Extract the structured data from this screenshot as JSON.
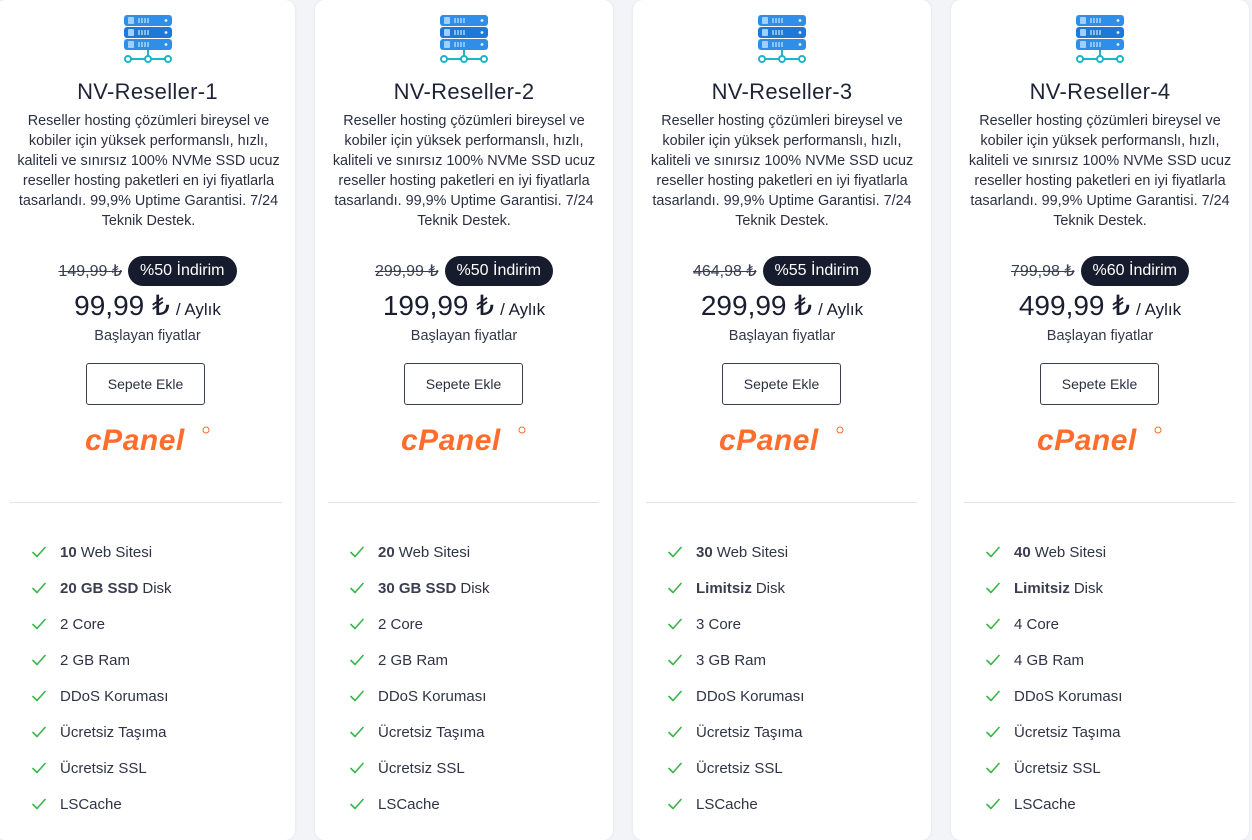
{
  "colors": {
    "page_bg": "#f3f4f8",
    "badge_bg": "#161b2d",
    "check_green": "#39b54a",
    "cpanel_orange": "#ff6c2c",
    "icon_blue": "#2a8de6"
  },
  "icons": {
    "plan": "server-icon",
    "feature": "check-icon",
    "logo": "cpanel-logo"
  },
  "common": {
    "description": "Reseller hosting çözümleri bireysel ve kobiler için yüksek performanslı, hızlı, kaliteli ve sınırsız 100% NVMe SSD ucuz reseller hosting paketleri en iyi fiyatlarla tasarlandı. 99,9% Uptime Garantisi. 7/24 Teknik Destek.",
    "period": "/ Aylık",
    "starting_label": "Başlayan fiyatlar",
    "cart_label": "Sepete Ekle",
    "logo_text": "cPanel"
  },
  "plans": [
    {
      "title": "NV-Reseller-1",
      "old_price": "149,99 ₺",
      "discount": "%50 İndirim",
      "price": "99,99 ₺",
      "features": [
        {
          "bold": "10",
          "text": "Web Sitesi"
        },
        {
          "bold": "20 GB SSD",
          "text": "Disk"
        },
        {
          "bold": "",
          "text": "2 Core"
        },
        {
          "bold": "",
          "text": "2 GB Ram"
        },
        {
          "bold": "",
          "text": "DDoS Koruması"
        },
        {
          "bold": "",
          "text": "Ücretsiz Taşıma"
        },
        {
          "bold": "",
          "text": "Ücretsiz SSL"
        },
        {
          "bold": "",
          "text": "LSCache"
        }
      ]
    },
    {
      "title": "NV-Reseller-2",
      "old_price": "299,99 ₺",
      "discount": "%50 İndirim",
      "price": "199,99 ₺",
      "features": [
        {
          "bold": "20",
          "text": "Web Sitesi"
        },
        {
          "bold": "30 GB SSD",
          "text": "Disk"
        },
        {
          "bold": "",
          "text": "2 Core"
        },
        {
          "bold": "",
          "text": "2 GB Ram"
        },
        {
          "bold": "",
          "text": "DDoS Koruması"
        },
        {
          "bold": "",
          "text": "Ücretsiz Taşıma"
        },
        {
          "bold": "",
          "text": "Ücretsiz SSL"
        },
        {
          "bold": "",
          "text": "LSCache"
        }
      ]
    },
    {
      "title": "NV-Reseller-3",
      "old_price": "464,98 ₺",
      "discount": "%55 İndirim",
      "price": "299,99 ₺",
      "features": [
        {
          "bold": "30",
          "text": "Web Sitesi"
        },
        {
          "bold": "Limitsiz",
          "text": "Disk"
        },
        {
          "bold": "",
          "text": "3 Core"
        },
        {
          "bold": "",
          "text": "3 GB Ram"
        },
        {
          "bold": "",
          "text": "DDoS Koruması"
        },
        {
          "bold": "",
          "text": "Ücretsiz Taşıma"
        },
        {
          "bold": "",
          "text": "Ücretsiz SSL"
        },
        {
          "bold": "",
          "text": "LSCache"
        }
      ]
    },
    {
      "title": "NV-Reseller-4",
      "old_price": "799,98 ₺",
      "discount": "%60 İndirim",
      "price": "499,99 ₺",
      "features": [
        {
          "bold": "40",
          "text": "Web Sitesi"
        },
        {
          "bold": "Limitsiz",
          "text": "Disk"
        },
        {
          "bold": "",
          "text": "4 Core"
        },
        {
          "bold": "",
          "text": "4 GB Ram"
        },
        {
          "bold": "",
          "text": "DDoS Koruması"
        },
        {
          "bold": "",
          "text": "Ücretsiz Taşıma"
        },
        {
          "bold": "",
          "text": "Ücretsiz SSL"
        },
        {
          "bold": "",
          "text": "LSCache"
        }
      ]
    }
  ]
}
